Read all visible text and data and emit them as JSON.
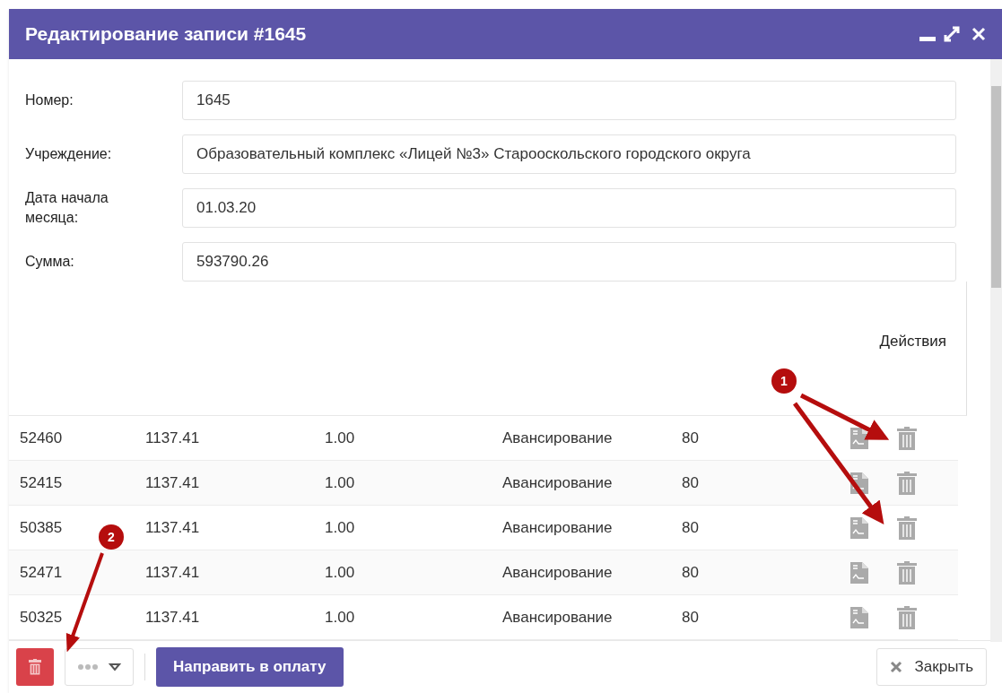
{
  "window": {
    "title": "Редактирование записи #1645"
  },
  "fields": [
    {
      "label": "Номер:",
      "value": "1645"
    },
    {
      "label": "Учреждение:",
      "value": "Образовательный комплекс «Лицей №3» Старооскольского городского округа"
    },
    {
      "label": "Дата начала месяца:",
      "value": "01.03.20"
    },
    {
      "label": "Сумма:",
      "value": "593790.26"
    }
  ],
  "table": {
    "actions_header": "Действия",
    "rows": [
      {
        "cells": [
          "52460",
          "1137.41",
          "1.00",
          "Авансирование",
          "80"
        ]
      },
      {
        "cells": [
          "52415",
          "1137.41",
          "1.00",
          "Авансирование",
          "80"
        ]
      },
      {
        "cells": [
          "50385",
          "1137.41",
          "1.00",
          "Авансирование",
          "80"
        ]
      },
      {
        "cells": [
          "52471",
          "1137.41",
          "1.00",
          "Авансирование",
          "80"
        ]
      },
      {
        "cells": [
          "50325",
          "1137.41",
          "1.00",
          "Авансирование",
          "80"
        ]
      }
    ]
  },
  "footer": {
    "primary_button": "Направить в оплату",
    "close_button": "Закрыть"
  },
  "callouts": [
    {
      "label": "1"
    },
    {
      "label": "2"
    }
  ]
}
